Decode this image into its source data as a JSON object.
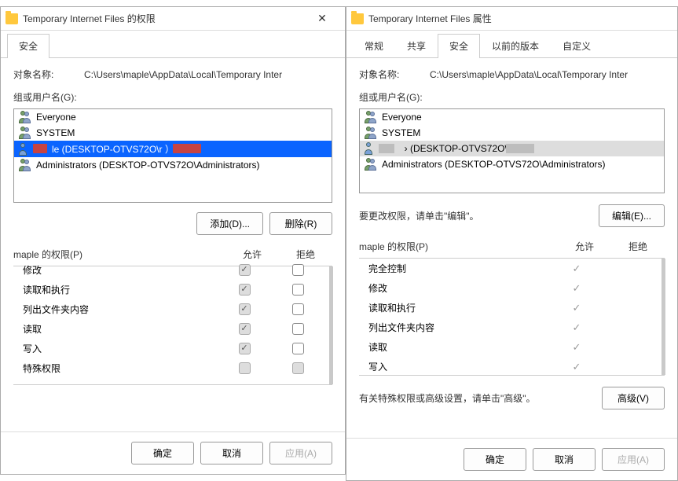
{
  "left": {
    "title": "Temporary Internet Files 的权限",
    "tabs": {
      "security": "安全"
    },
    "object_name_label": "对象名称:",
    "object_name": "C:\\Users\\maple\\AppData\\Local\\Temporary Inter",
    "groups_label": "组或用户名(G):",
    "users": [
      {
        "label": "Everyone"
      },
      {
        "label": "SYSTEM"
      },
      {
        "label": "le (DESKTOP-OTVS72O\\r        ）",
        "selected": true
      },
      {
        "label": "Administrators (DESKTOP-OTVS72O\\Administrators)"
      }
    ],
    "add_btn": "添加(D)...",
    "remove_btn": "删除(R)",
    "perm_title": "maple 的权限(P)",
    "col_allow": "允许",
    "col_deny": "拒绝",
    "perms": [
      {
        "name": "修改",
        "allow": true,
        "deny": false,
        "cut": true
      },
      {
        "name": "读取和执行",
        "allow": true,
        "deny": false
      },
      {
        "name": "列出文件夹内容",
        "allow": true,
        "deny": false
      },
      {
        "name": "读取",
        "allow": true,
        "deny": false
      },
      {
        "name": "写入",
        "allow": true,
        "deny": false
      },
      {
        "name": "特殊权限",
        "allow": false,
        "deny": false
      }
    ],
    "ok_btn": "确定",
    "cancel_btn": "取消",
    "apply_btn": "应用(A)"
  },
  "right": {
    "title": "Temporary Internet Files 属性",
    "tabs": {
      "general": "常规",
      "share": "共享",
      "security": "安全",
      "previous": "以前的版本",
      "custom": "自定义"
    },
    "object_name_label": "对象名称:",
    "object_name": "C:\\Users\\maple\\AppData\\Local\\Temporary Inter",
    "groups_label": "组或用户名(G):",
    "users": [
      {
        "label": "Everyone"
      },
      {
        "label": "SYSTEM"
      },
      {
        "label": "    › (DESKTOP-OTVS72O\\r",
        "selected": true
      },
      {
        "label": "Administrators (DESKTOP-OTVS72O\\Administrators)"
      }
    ],
    "edit_hint": "要更改权限，请单击\"编辑\"。",
    "edit_btn": "编辑(E)...",
    "perm_title": "maple 的权限(P)",
    "col_allow": "允许",
    "col_deny": "拒绝",
    "perms": [
      {
        "name": "完全控制",
        "allow": true
      },
      {
        "name": "修改",
        "allow": true
      },
      {
        "name": "读取和执行",
        "allow": true
      },
      {
        "name": "列出文件夹内容",
        "allow": true
      },
      {
        "name": "读取",
        "allow": true
      },
      {
        "name": "写入",
        "allow": true
      }
    ],
    "adv_hint": "有关特殊权限或高级设置，请单击\"高级\"。",
    "adv_btn": "高级(V)",
    "ok_btn": "确定",
    "cancel_btn": "取消",
    "apply_btn": "应用(A)"
  }
}
